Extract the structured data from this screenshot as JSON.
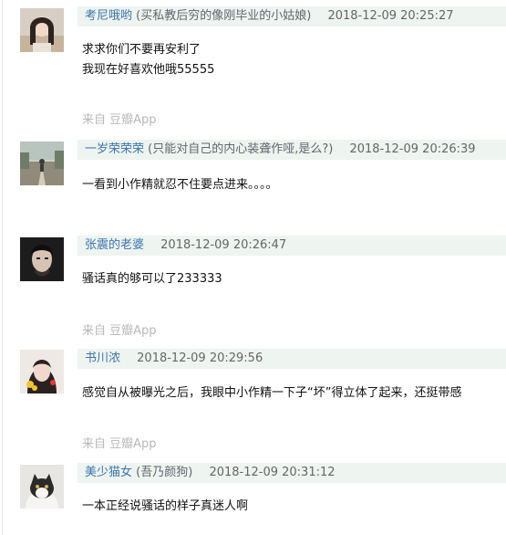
{
  "comments": [
    {
      "user": "考尼哦哟",
      "signature": "(买私教后穷的像刚毕业的小姑娘)",
      "time": "2018-12-09 20:25:27",
      "lines": [
        "求求你们不要再安利了",
        "我现在好喜欢他哦55555"
      ],
      "via_prefix": "来自",
      "via_app": "豆瓣App"
    },
    {
      "user": "一岁荣荣荣",
      "signature": "(只能对自己的内心装聋作哑,是么?)",
      "time": "2018-12-09 20:26:39",
      "lines": [
        "一看到小作精就忍不住要点进来。。。。"
      ]
    },
    {
      "user": "张震的老婆",
      "signature": "",
      "time": "2018-12-09 20:26:47",
      "lines": [
        "骚话真的够可以了233333"
      ],
      "via_prefix": "来自",
      "via_app": "豆瓣App"
    },
    {
      "user": "书川浓",
      "signature": "",
      "time": "2018-12-09 20:29:56",
      "lines": [
        "感觉自从被曝光之后，我眼中小作精一下子“坏”得立体了起来，还挺带感"
      ],
      "via_prefix": "来自",
      "via_app": "豆瓣App"
    },
    {
      "user": "美少猫女",
      "signature": "(吾乃颜狗)",
      "time": "2018-12-09 20:31:12",
      "lines": [
        "一本正经说骚话的样子真迷人啊"
      ]
    }
  ],
  "colors": {
    "meta_bg": "#eef4ef",
    "username": "#3a74b1",
    "via": "#b8b8b8"
  }
}
